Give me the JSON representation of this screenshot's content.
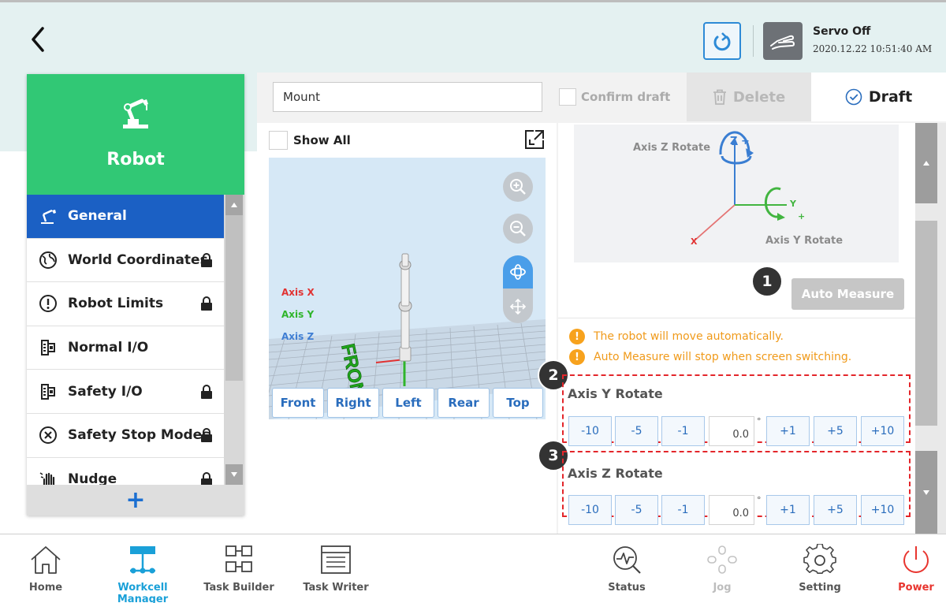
{
  "header": {
    "servo_status": "Servo Off",
    "datetime": "2020.12.22 10:51:40 AM"
  },
  "sidebar": {
    "title": "Robot",
    "items": [
      {
        "label": "General",
        "icon": "robot-arm-icon",
        "active": true,
        "locked": false
      },
      {
        "label": "World Coordinates",
        "icon": "globe-icon",
        "active": false,
        "locked": true
      },
      {
        "label": "Robot Limits",
        "icon": "alert-circle-icon",
        "active": false,
        "locked": true
      },
      {
        "label": "Normal I/O",
        "icon": "io-icon",
        "active": false,
        "locked": false
      },
      {
        "label": "Safety I/O",
        "icon": "io-icon",
        "active": false,
        "locked": true
      },
      {
        "label": "Safety Stop Modes",
        "icon": "stop-circle-icon",
        "active": false,
        "locked": true
      },
      {
        "label": "Nudge",
        "icon": "hand-icon",
        "active": false,
        "locked": true
      }
    ],
    "add_label": "+"
  },
  "toolbar": {
    "name_value": "Mount",
    "confirm_label": "Confirm draft",
    "delete_label": "Delete",
    "draft_label": "Draft"
  },
  "viewer": {
    "show_all_label": "Show All",
    "axis_x": "Axis X",
    "axis_y": "Axis Y",
    "axis_z": "Axis Z",
    "floor_label": "FRONT",
    "views": [
      "Front",
      "Right",
      "Left",
      "Rear",
      "Top"
    ]
  },
  "mount": {
    "diagram": {
      "z_rotate_label": "Axis Z Rotate",
      "y_rotate_label": "Axis Y Rotate",
      "z_axis": "Z +",
      "y_axis": "Y",
      "x_axis": "X",
      "plus": "+"
    },
    "auto_measure_label": "Auto Measure",
    "warnings": [
      "The robot will move automatically.",
      "Auto Measure will stop when screen switching."
    ],
    "badges": [
      "1",
      "2",
      "3"
    ],
    "y_rotate": {
      "title": "Axis Y Rotate",
      "steps_minus": [
        "-10",
        "-5",
        "-1"
      ],
      "value": "0.0",
      "degree": "°",
      "steps_plus": [
        "+1",
        "+5",
        "+10"
      ]
    },
    "z_rotate": {
      "title": "Axis Z Rotate",
      "steps_minus": [
        "-10",
        "-5",
        "-1"
      ],
      "value": "0.0",
      "degree": "°",
      "steps_plus": [
        "+1",
        "+5",
        "+10"
      ]
    }
  },
  "bottom_nav": [
    {
      "label": "Home",
      "icon": "home-icon",
      "active": false,
      "disabled": false
    },
    {
      "label": "Workcell Manager",
      "icon": "workcell-icon",
      "active": true,
      "disabled": false
    },
    {
      "label": "Task Builder",
      "icon": "task-builder-icon",
      "active": false,
      "disabled": false
    },
    {
      "label": "Task Writer",
      "icon": "task-writer-icon",
      "active": false,
      "disabled": false
    },
    {
      "label": "Status",
      "icon": "status-icon",
      "active": false,
      "disabled": false
    },
    {
      "label": "Jog",
      "icon": "jog-icon",
      "active": false,
      "disabled": true
    },
    {
      "label": "Setting",
      "icon": "gear-icon",
      "active": false,
      "disabled": false
    },
    {
      "label": "Power",
      "icon": "power-icon",
      "active": false,
      "disabled": false
    }
  ],
  "colors": {
    "accent_blue": "#1b60c4",
    "robot_green": "#31c875",
    "warning_orange": "#f09a1a",
    "highlight_red": "#e3262b",
    "power_red": "#e8352f",
    "active_nav": "#1aa0d8"
  }
}
